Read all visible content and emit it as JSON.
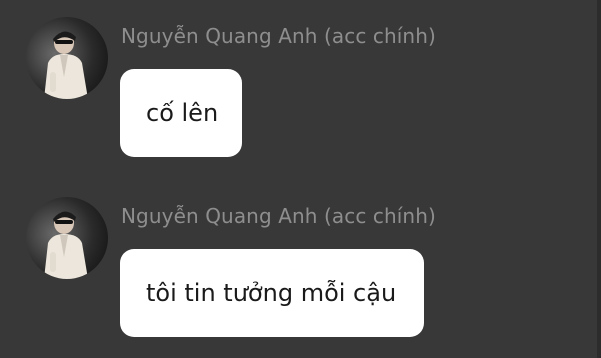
{
  "messages": [
    {
      "sender": "Nguyễn Quang Anh (acc chính)",
      "text": "cố lên"
    },
    {
      "sender": "Nguyễn Quang Anh (acc chính)",
      "text": "tôi tin tưởng mỗi cậu"
    }
  ],
  "colors": {
    "background": "#383838",
    "bubble": "#ffffff",
    "sender_name": "#8e8e8e",
    "message_text": "#1a1a1a"
  },
  "icons": {
    "avatar": "user-avatar-photo"
  }
}
